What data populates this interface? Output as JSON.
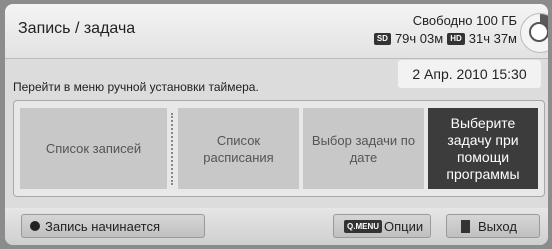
{
  "header": {
    "title": "Запись / задача",
    "free_space": "Свободно 100 ГБ",
    "sd_badge": "SD",
    "sd_time": "79ч 03м",
    "hd_badge": "HD",
    "hd_time": "31ч 37м",
    "disk_icon": "disk-usage-icon"
  },
  "hint": "Перейти в меню ручной установки таймера.",
  "date": "2 Апр. 2010 15:30",
  "menu": {
    "items": [
      {
        "label": "Список записей"
      },
      {
        "label": "Список расписания"
      },
      {
        "label": "Выбор задачи по дате"
      },
      {
        "label": "Выберите задачу при помощи программы"
      }
    ],
    "selected_index": 3
  },
  "footer": {
    "record_label": "Запись начинается",
    "qmenu_badge": "Q.MENU",
    "options_label": "Опции",
    "exit_label": "Выход"
  },
  "colors": {
    "selected_bg": "#3c3c3c",
    "item_bg": "#c8c8c8",
    "panel_bg": "#dcdcdc"
  }
}
